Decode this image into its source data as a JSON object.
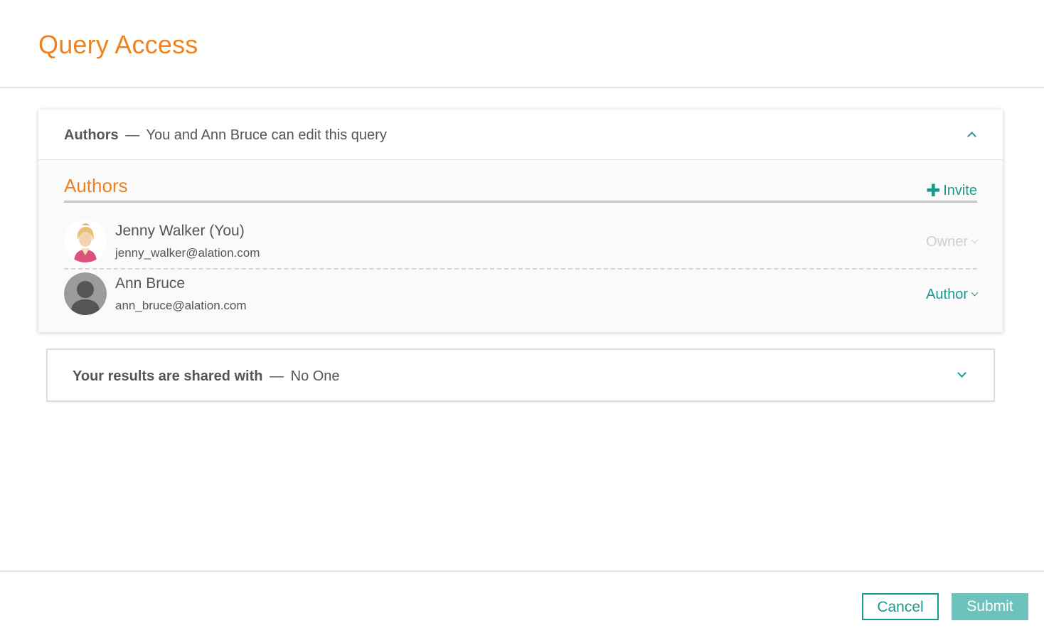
{
  "header": {
    "title": "Query Access"
  },
  "authors_panel": {
    "heading_label": "Authors",
    "heading_separator": "—",
    "heading_description": "You and Ann Bruce can edit this query",
    "expanded": true,
    "section_title": "Authors",
    "invite_label": "Invite",
    "invite_icon": "plus-icon",
    "members": [
      {
        "name": "Jenny Walker (You)",
        "email": "jenny_walker@alation.com",
        "role": "Owner",
        "role_enabled": false,
        "avatar": "female-user-avatar"
      },
      {
        "name": "Ann Bruce",
        "email": "ann_bruce@alation.com",
        "role": "Author",
        "role_enabled": true,
        "avatar": "default-user-avatar"
      }
    ]
  },
  "shared_panel": {
    "heading_label": "Your results are shared with",
    "heading_separator": "—",
    "heading_description": "No One",
    "expanded": false
  },
  "footer": {
    "cancel_label": "Cancel",
    "submit_label": "Submit"
  },
  "colors": {
    "accent_orange": "#f0821e",
    "accent_teal": "#1a9a8e",
    "submit_disabled": "#6dc3bb"
  }
}
